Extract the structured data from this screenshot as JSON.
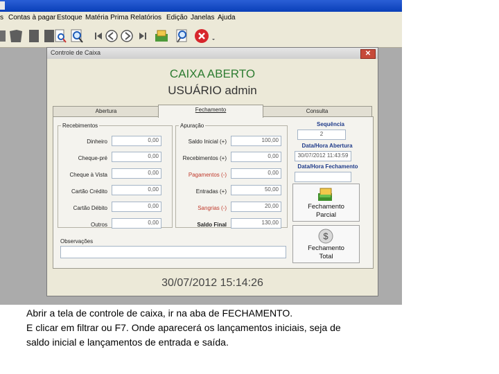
{
  "menubar": {
    "items": [
      "Contas à pagar",
      "Estoque",
      "Matéria Prima",
      "Relatórios",
      "Edição",
      "Janelas",
      "Ajuda"
    ]
  },
  "toolbar": {
    "icons": [
      "document-icon",
      "find-doc-icon",
      "search-icon",
      "first-icon",
      "prev-icon",
      "next-icon",
      "last-icon",
      "money-icon",
      "zoom-icon",
      "close-icon"
    ]
  },
  "dialog": {
    "title": "Controle de Caixa",
    "heading1": "CAIXA ABERTO",
    "heading2": "USUÁRIO admin",
    "tabs": [
      "Abertura",
      "Fechamento",
      "Consulta"
    ],
    "recebimentos": {
      "legend": "Recebimentos",
      "rows": [
        {
          "label": "Dinheiro",
          "value": "0,00"
        },
        {
          "label": "Cheque-pré",
          "value": "0,00"
        },
        {
          "label": "Cheque à Vista",
          "value": "0,00"
        },
        {
          "label": "Cartão Crédito",
          "value": "0,00"
        },
        {
          "label": "Cartão Débito",
          "value": "0,00"
        },
        {
          "label": "Outros",
          "value": "0,00"
        }
      ]
    },
    "apuracao": {
      "legend": "Apuração",
      "rows": [
        {
          "label": "Saldo Inicial (+)",
          "value": "100,00"
        },
        {
          "label": "Recebimentos (+)",
          "value": "0,00"
        },
        {
          "label": "Pagamentos (-)",
          "value": "0,00"
        },
        {
          "label": "Entradas (+)",
          "value": "50,00"
        },
        {
          "label": "Sangrias (-)",
          "value": "20,00"
        }
      ],
      "total_label": "Saldo Final",
      "total_value": "130,00"
    },
    "sequencia_label": "Sequência",
    "sequencia_value": "2",
    "abertura_label": "Data/Hora Abertura",
    "abertura_value": "30/07/2012 11:43:59",
    "fechamento_label": "Data/Hora Fechamento",
    "fechamento_value": "",
    "btn_parcial": [
      "Fechamento",
      "Parcial"
    ],
    "btn_total": [
      "Fechamento",
      "Total"
    ],
    "observacoes_label": "Observações",
    "observacoes_value": "",
    "datetime": "30/07/2012 15:14:26"
  },
  "colors": {
    "heading": "#333333",
    "legend_blue": "#1f3b8a",
    "pagamentos_red": "#c0392b",
    "close_red": "#c64b3a"
  },
  "caption": [
    "Abrir a tela de controle de caixa, ir na aba de FECHAMENTO.",
    "E clicar em filtrar ou F7. Onde aparecerá os lançamentos iniciais, seja de",
    "saldo inicial e lançamentos de entrada e saída."
  ]
}
